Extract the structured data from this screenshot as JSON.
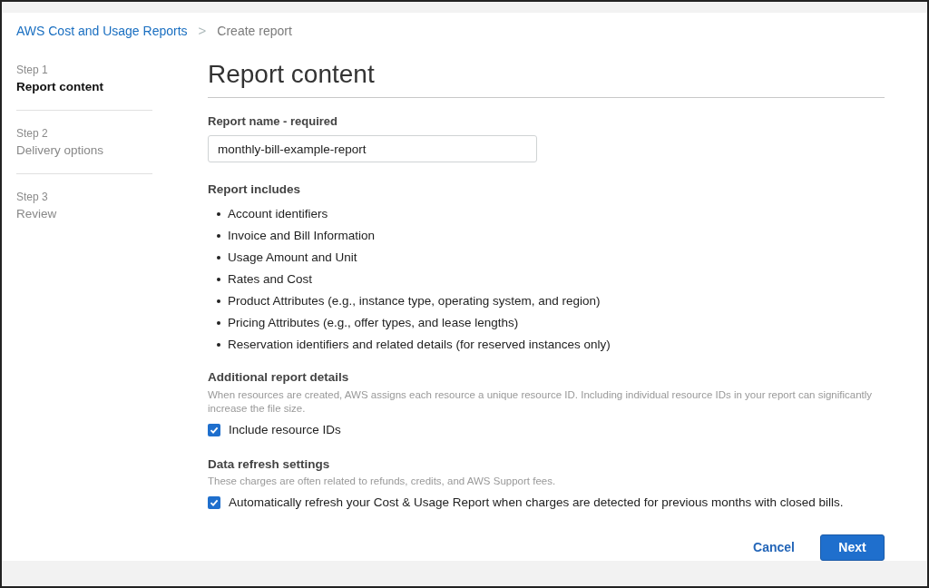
{
  "breadcrumb": {
    "link": "AWS Cost and Usage Reports",
    "separator": ">",
    "current": "Create report"
  },
  "steps": [
    {
      "label": "Step 1",
      "name": "Report content",
      "selected": true
    },
    {
      "label": "Step 2",
      "name": "Delivery options",
      "selected": false
    },
    {
      "label": "Step 3",
      "name": "Review",
      "selected": false
    }
  ],
  "title": "Report content",
  "report_name": {
    "label": "Report name - required",
    "value": "monthly-bill-example-report"
  },
  "report_includes": {
    "heading": "Report includes",
    "items": [
      "Account identifiers",
      "Invoice and Bill Information",
      "Usage Amount and Unit",
      "Rates and Cost",
      "Product Attributes (e.g., instance type, operating system, and region)",
      "Pricing Attributes (e.g., offer types, and lease lengths)",
      "Reservation identifiers and related details (for reserved instances only)"
    ]
  },
  "sections": [
    {
      "heading": "Additional report details",
      "description": "When resources are created, AWS assigns each resource a unique resource ID. Including individual resource IDs in your report can significantly increase the file size.",
      "option": {
        "label": "Include resource IDs",
        "checked": true
      }
    },
    {
      "heading": "Data refresh settings",
      "description": "These charges are often related to refunds, credits, and AWS Support fees.",
      "option": {
        "label": "Automatically refresh your Cost & Usage Report when charges are detected for previous months with closed bills.",
        "checked": true
      }
    }
  ],
  "buttons": {
    "cancel": "Cancel",
    "next": "Next"
  }
}
